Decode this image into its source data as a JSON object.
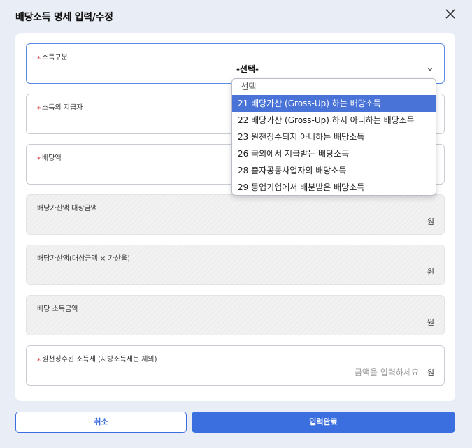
{
  "dialog": {
    "title": "배당소득 명세 입력/수정",
    "close_icon": "close-icon"
  },
  "fields": {
    "income_type": {
      "required_mark": "*",
      "label": "소득구분",
      "value": "-선택-"
    },
    "payer": {
      "required_mark": "*",
      "label": "소득의 지급자"
    },
    "dividend_amount": {
      "required_mark": "*",
      "label": "배당액"
    },
    "grossup_base": {
      "label": "배당가산액 대상금액",
      "unit": "원"
    },
    "grossup_amount": {
      "label": "배당가산액(대상금액 × 가산율)",
      "unit": "원"
    },
    "dividend_income": {
      "label": "배당 소득금액",
      "unit": "원"
    },
    "withheld_tax": {
      "required_mark": "*",
      "label": "원천징수된 소득세 (지방소득세는 제외)",
      "placeholder": "금액을 입력하세요",
      "unit": "원"
    }
  },
  "dropdown": {
    "options": [
      "-선택-",
      "21 배당가산 (Gross-Up) 하는 배당소득",
      "22 배당가산 (Gross-Up) 하지 아니하는 배당소득",
      "23 원천징수되지 아니하는 배당소득",
      "26 국외에서 지급받는 배당소득",
      "28 출자공동사업자의 배당소득",
      "29 동업기업에서 배분받은 배당소득"
    ],
    "highlighted_index": 1
  },
  "buttons": {
    "cancel": "취소",
    "submit": "입력완료"
  },
  "colors": {
    "accent": "#3b6fe0",
    "highlight": "#4a73d8",
    "required": "#e03131"
  }
}
